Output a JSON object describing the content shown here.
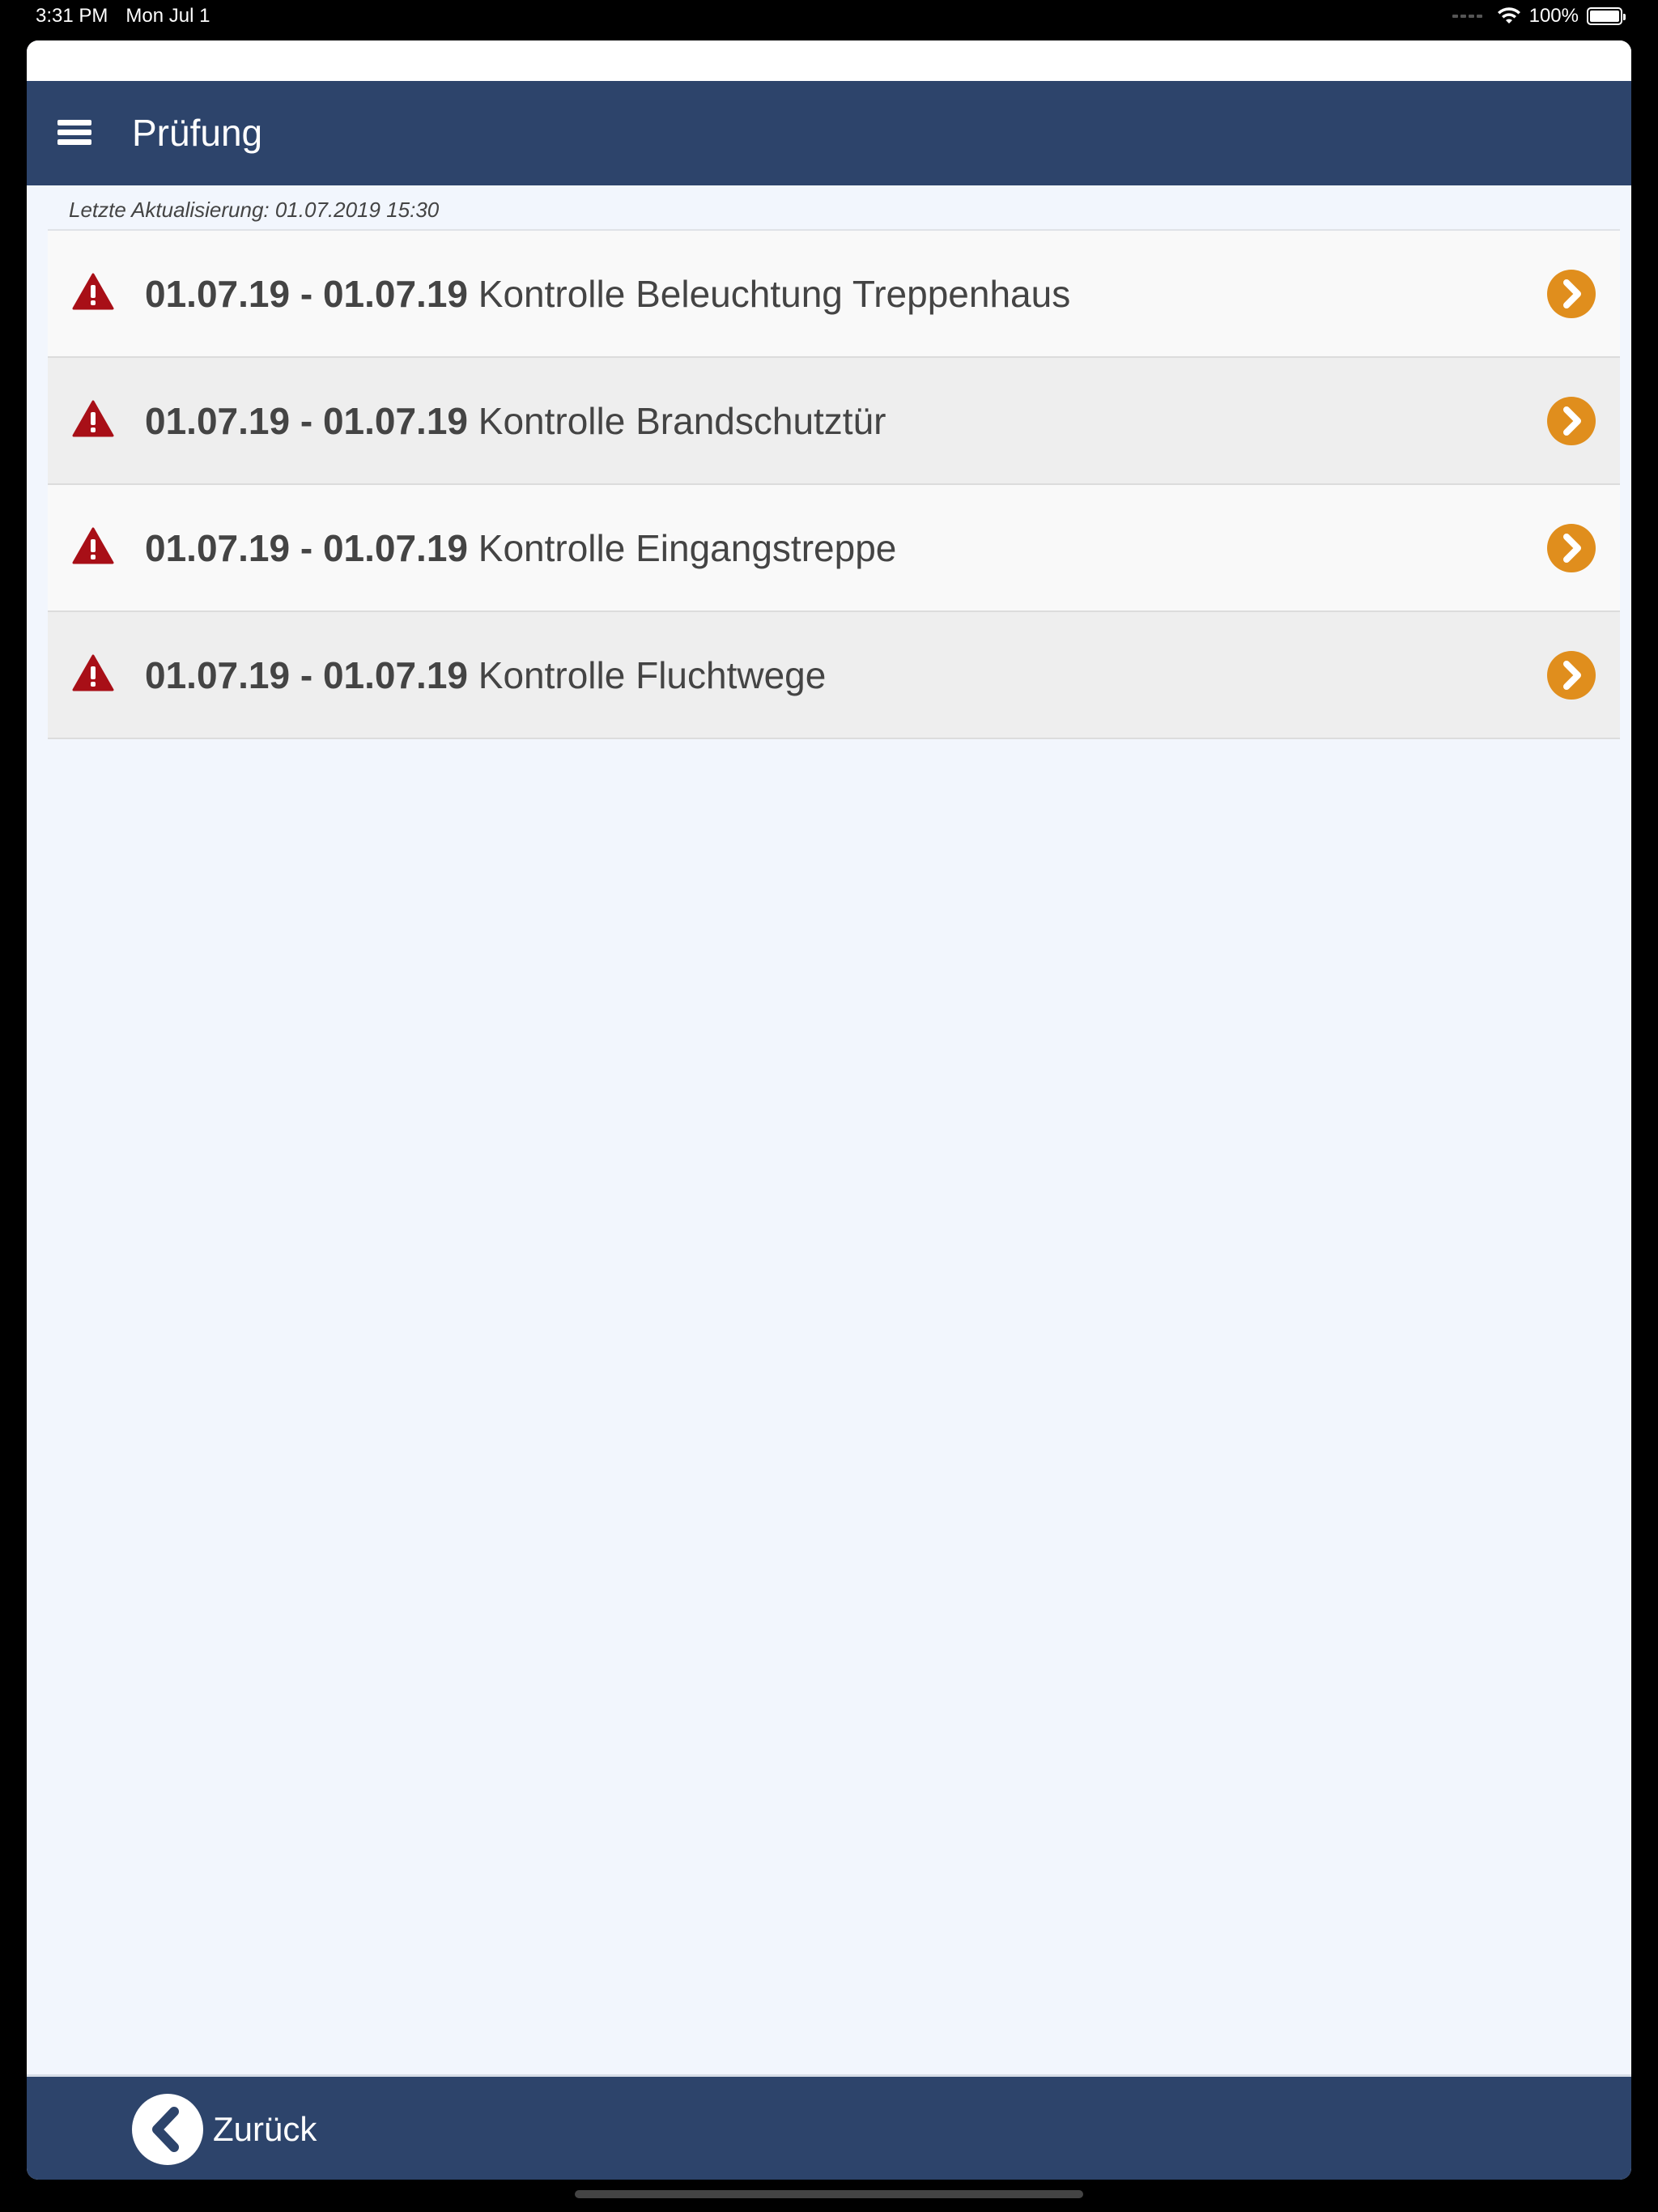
{
  "status_bar": {
    "time": "3:31 PM",
    "date": "Mon Jul 1",
    "battery": "100%",
    "icons": [
      "cellular-signal-icon",
      "wifi-icon",
      "battery-icon"
    ]
  },
  "header": {
    "title": "Prüfung",
    "menu_icon": "hamburger-menu-icon"
  },
  "last_update": "Letzte Aktualisierung: 01.07.2019 15:30",
  "items": [
    {
      "dates": "01.07.19 - 01.07.19",
      "title": "Kontrolle Beleuchtung Treppenhaus"
    },
    {
      "dates": "01.07.19 - 01.07.19",
      "title": "Kontrolle Brandschutztür"
    },
    {
      "dates": "01.07.19 - 01.07.19",
      "title": "Kontrolle Eingangstreppe"
    },
    {
      "dates": "01.07.19 - 01.07.19",
      "title": "Kontrolle Fluchtwege"
    }
  ],
  "footer": {
    "back_label": "Zurück",
    "back_icon": "chevron-left-icon"
  },
  "colors": {
    "header_bg": "#2d446b",
    "page_bg": "#f2f6fd",
    "warning_red": "#a80f17",
    "accent_orange": "#e08e1d",
    "text": "#444444"
  }
}
